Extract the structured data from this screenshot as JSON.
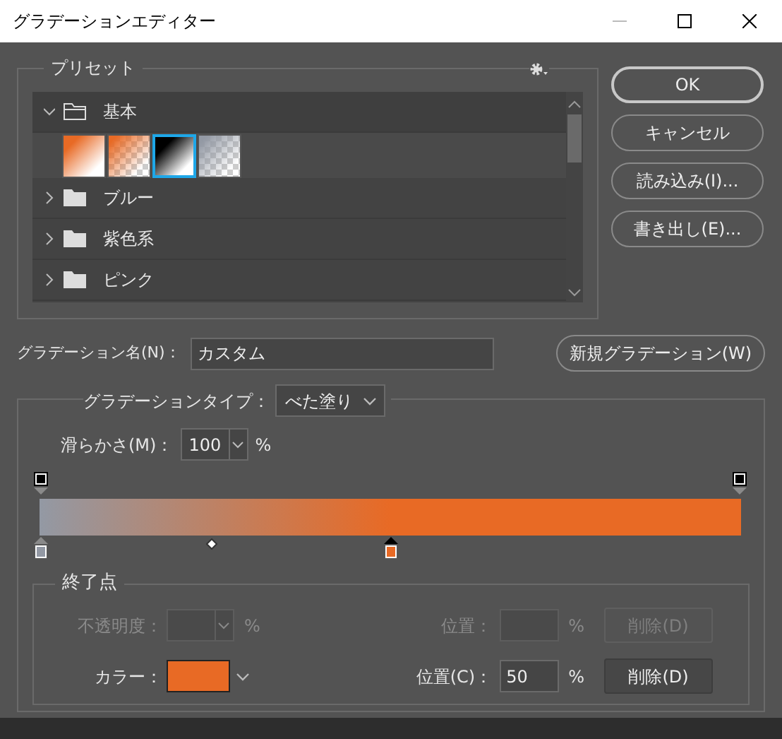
{
  "window": {
    "title": "グラデーションエディター"
  },
  "presets": {
    "label": "プリセット",
    "groups": [
      {
        "name": "基本",
        "expanded": true,
        "swatches": [
          {
            "selected": false
          },
          {
            "selected": false
          },
          {
            "selected": true
          },
          {
            "selected": false
          }
        ]
      },
      {
        "name": "ブルー",
        "expanded": false
      },
      {
        "name": "紫色系",
        "expanded": false
      },
      {
        "name": "ピンク",
        "expanded": false
      }
    ]
  },
  "buttons": [
    "OK",
    "キャンセル",
    "読み込み(I)...",
    "書き出し(E)..."
  ],
  "name_field": {
    "label": "グラデーション名(N)：",
    "value": "カスタム"
  },
  "new_button": "新規グラデーション(W)",
  "gradient_type": {
    "label": "グラデーションタイプ：",
    "value": "べた塗り"
  },
  "smoothness": {
    "label": "滑らかさ(M)：",
    "value": "100",
    "unit": "%"
  },
  "opacity_stops": [
    {
      "selected": false
    },
    {
      "selected": false
    }
  ],
  "color_stops": [
    {
      "color": "#9399a4",
      "selected": false
    },
    {
      "color": "#e86a25",
      "selected": true
    }
  ],
  "stops": {
    "label": "終了点",
    "opacity": {
      "label": "不透明度：",
      "unit": "%",
      "position_label": "位置：",
      "position_unit": "%",
      "delete": "削除(D)",
      "disabled": true
    },
    "color": {
      "label": "カラー：",
      "color": "#e86a25",
      "position_label": "位置(C)：",
      "position_value": "50",
      "position_unit": "%",
      "delete": "削除(D)",
      "disabled": false
    }
  }
}
